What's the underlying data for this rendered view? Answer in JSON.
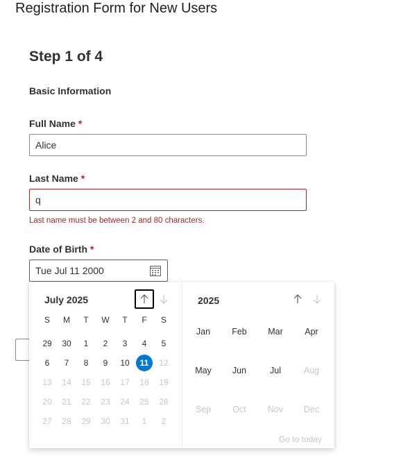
{
  "page": {
    "title": "Registration Form for New Users"
  },
  "step": {
    "title": "Step 1 of 4",
    "section": "Basic Information"
  },
  "fields": {
    "full_name": {
      "label": "Full Name",
      "required_mark": "*",
      "value": "Alice"
    },
    "last_name": {
      "label": "Last Name",
      "required_mark": "*",
      "value": "q",
      "error": "Last name must be between 2 and 80 characters."
    },
    "dob": {
      "label": "Date of Birth",
      "required_mark": "*",
      "value": "Tue Jul 11 2000"
    }
  },
  "calendar": {
    "month_label": "July 2025",
    "weekdays": [
      "S",
      "M",
      "T",
      "W",
      "T",
      "F",
      "S"
    ],
    "weeks": [
      [
        {
          "d": "29",
          "en": true
        },
        {
          "d": "30",
          "en": true
        },
        {
          "d": "1",
          "en": true
        },
        {
          "d": "2",
          "en": true
        },
        {
          "d": "3",
          "en": true
        },
        {
          "d": "4",
          "en": true
        },
        {
          "d": "5",
          "en": true
        }
      ],
      [
        {
          "d": "6",
          "en": true
        },
        {
          "d": "7",
          "en": true
        },
        {
          "d": "8",
          "en": true
        },
        {
          "d": "9",
          "en": true
        },
        {
          "d": "10",
          "en": true
        },
        {
          "d": "11",
          "en": true,
          "selected": true
        },
        {
          "d": "12",
          "en": false
        }
      ],
      [
        {
          "d": "13",
          "en": false
        },
        {
          "d": "14",
          "en": false
        },
        {
          "d": "15",
          "en": false
        },
        {
          "d": "16",
          "en": false
        },
        {
          "d": "17",
          "en": false
        },
        {
          "d": "18",
          "en": false
        },
        {
          "d": "19",
          "en": false
        }
      ],
      [
        {
          "d": "20",
          "en": false
        },
        {
          "d": "21",
          "en": false
        },
        {
          "d": "22",
          "en": false
        },
        {
          "d": "23",
          "en": false
        },
        {
          "d": "24",
          "en": false
        },
        {
          "d": "25",
          "en": false
        },
        {
          "d": "26",
          "en": false
        }
      ],
      [
        {
          "d": "27",
          "en": false
        },
        {
          "d": "28",
          "en": false
        },
        {
          "d": "29",
          "en": false
        },
        {
          "d": "30",
          "en": false
        },
        {
          "d": "31",
          "en": false
        },
        {
          "d": "1",
          "en": false
        },
        {
          "d": "2",
          "en": false
        }
      ]
    ],
    "year_label": "2025",
    "months": [
      {
        "m": "Jan",
        "en": true
      },
      {
        "m": "Feb",
        "en": true
      },
      {
        "m": "Mar",
        "en": true
      },
      {
        "m": "Apr",
        "en": true
      },
      {
        "m": "May",
        "en": true
      },
      {
        "m": "Jun",
        "en": true
      },
      {
        "m": "Jul",
        "en": true
      },
      {
        "m": "Aug",
        "en": false
      },
      {
        "m": "Sep",
        "en": false
      },
      {
        "m": "Oct",
        "en": false
      },
      {
        "m": "Nov",
        "en": false
      },
      {
        "m": "Dec",
        "en": false
      }
    ],
    "go_to_today": "Go to today"
  },
  "icons": {
    "calendar": "calendar-icon",
    "prev": "arrow-up-icon",
    "next": "arrow-down-icon"
  },
  "colors": {
    "accent": "#0078d4",
    "error": "#a4262c",
    "disabled": "#c8c6c4",
    "text": "#323130"
  }
}
